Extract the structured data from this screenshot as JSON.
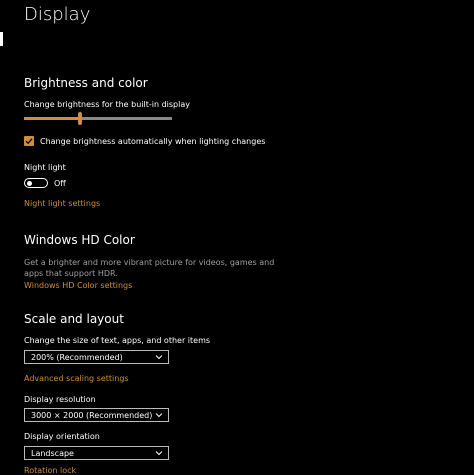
{
  "page": {
    "title": "Display"
  },
  "colors": {
    "accent": "#d28d3a",
    "background": "#000000",
    "text": "#ffffff",
    "muted": "#a0a0a0"
  },
  "brightness": {
    "heading": "Brightness and color",
    "slider_label": "Change brightness for the built-in display",
    "slider_value_percent": 38,
    "auto_checkbox_label": "Change brightness automatically when lighting changes",
    "auto_checked": true,
    "night_light_label": "Night light",
    "night_light_state": "Off",
    "night_light_settings_link": "Night light settings"
  },
  "hd_color": {
    "heading": "Windows HD Color",
    "description": "Get a brighter and more vibrant picture for videos, games and apps that support HDR.",
    "settings_link": "Windows HD Color settings"
  },
  "scale": {
    "heading": "Scale and layout",
    "size_label": "Change the size of text, apps, and other items",
    "size_value": "200% (Recommended)",
    "advanced_link": "Advanced scaling settings",
    "resolution_label": "Display resolution",
    "resolution_value": "3000 × 2000 (Recommended)",
    "orientation_label": "Display orientation",
    "orientation_value": "Landscape",
    "footer_link_partial": "Rotation lock"
  },
  "icons": {
    "check": "check-icon",
    "chevron": "chevron-down-icon"
  }
}
